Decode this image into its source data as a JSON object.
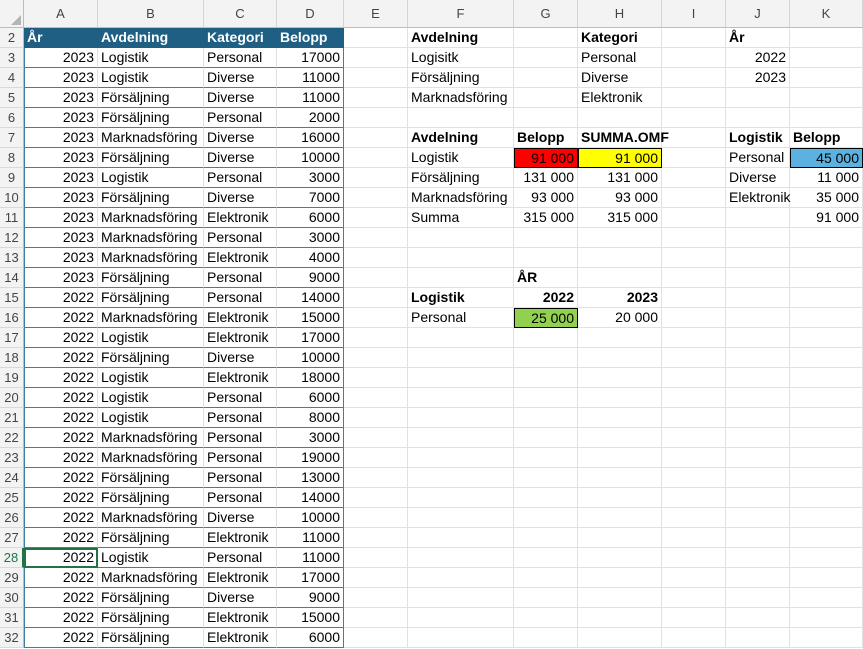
{
  "columns": [
    "A",
    "B",
    "C",
    "D",
    "E",
    "F",
    "G",
    "H",
    "I",
    "J",
    "K"
  ],
  "rows": [
    "2",
    "3",
    "4",
    "5",
    "6",
    "7",
    "8",
    "9",
    "10",
    "11",
    "12",
    "13",
    "14",
    "15",
    "16",
    "17",
    "18",
    "19",
    "20",
    "21",
    "22",
    "23",
    "24",
    "25",
    "26",
    "27",
    "28",
    "29",
    "30",
    "31",
    "32"
  ],
  "selected_row": "28",
  "colors": {
    "header_fill": "#1f5f83",
    "red": "#ff0000",
    "yellow": "#ffff00",
    "green": "#92d050",
    "blue": "#5bb1df",
    "selection": "#217346"
  },
  "table": {
    "headers": [
      "År",
      "Avdelning",
      "Kategori",
      "Belopp"
    ],
    "rows": [
      [
        "2023",
        "Logistik",
        "Personal",
        "17000"
      ],
      [
        "2023",
        "Logistik",
        "Diverse",
        "11000"
      ],
      [
        "2023",
        "Försäljning",
        "Diverse",
        "11000"
      ],
      [
        "2023",
        "Försäljning",
        "Personal",
        "2000"
      ],
      [
        "2023",
        "Marknadsföring",
        "Diverse",
        "16000"
      ],
      [
        "2023",
        "Försäljning",
        "Diverse",
        "10000"
      ],
      [
        "2023",
        "Logistik",
        "Personal",
        "3000"
      ],
      [
        "2023",
        "Försäljning",
        "Diverse",
        "7000"
      ],
      [
        "2023",
        "Marknadsföring",
        "Elektronik",
        "6000"
      ],
      [
        "2023",
        "Marknadsföring",
        "Personal",
        "3000"
      ],
      [
        "2023",
        "Marknadsföring",
        "Elektronik",
        "4000"
      ],
      [
        "2023",
        "Försäljning",
        "Personal",
        "9000"
      ],
      [
        "2022",
        "Försäljning",
        "Personal",
        "14000"
      ],
      [
        "2022",
        "Marknadsföring",
        "Elektronik",
        "15000"
      ],
      [
        "2022",
        "Logistik",
        "Elektronik",
        "17000"
      ],
      [
        "2022",
        "Försäljning",
        "Diverse",
        "10000"
      ],
      [
        "2022",
        "Logistik",
        "Elektronik",
        "18000"
      ],
      [
        "2022",
        "Logistik",
        "Personal",
        "6000"
      ],
      [
        "2022",
        "Logistik",
        "Personal",
        "8000"
      ],
      [
        "2022",
        "Marknadsföring",
        "Personal",
        "3000"
      ],
      [
        "2022",
        "Marknadsföring",
        "Personal",
        "19000"
      ],
      [
        "2022",
        "Försäljning",
        "Personal",
        "13000"
      ],
      [
        "2022",
        "Försäljning",
        "Personal",
        "14000"
      ],
      [
        "2022",
        "Marknadsföring",
        "Diverse",
        "10000"
      ],
      [
        "2022",
        "Försäljning",
        "Elektronik",
        "11000"
      ],
      [
        "2022",
        "Logistik",
        "Personal",
        "11000"
      ],
      [
        "2022",
        "Marknadsföring",
        "Elektronik",
        "17000"
      ],
      [
        "2022",
        "Försäljning",
        "Diverse",
        "9000"
      ],
      [
        "2022",
        "Försäljning",
        "Elektronik",
        "15000"
      ],
      [
        "2022",
        "Försäljning",
        "Elektronik",
        "6000"
      ]
    ]
  },
  "criteria": {
    "avd_header": "Avdelning",
    "avd_items": [
      "Logisitk",
      "Försäljning",
      "Marknadsföring"
    ],
    "kat_header": "Kategori",
    "kat_items": [
      "Personal",
      "Diverse",
      "Elektronik"
    ],
    "ar_header": "År",
    "ar_items": [
      "2022",
      "2023"
    ]
  },
  "summary": {
    "headers": [
      "Avdelning",
      "Belopp",
      "SUMMA.OMF"
    ],
    "rows": [
      [
        "Logistik",
        "91 000",
        "91 000"
      ],
      [
        "Försäljning",
        "131 000",
        "131 000"
      ],
      [
        "Marknadsföring",
        "93 000",
        "93 000"
      ],
      [
        "Summa",
        "315 000",
        "315 000"
      ]
    ]
  },
  "logistik_table": {
    "headers": [
      "Logistik",
      "Belopp"
    ],
    "rows": [
      [
        "Personal",
        "45 000"
      ],
      [
        "Diverse",
        "11 000"
      ],
      [
        "Elektronik",
        "35 000"
      ],
      [
        "",
        "91 000"
      ]
    ]
  },
  "year_table": {
    "title": "ÅR",
    "label": "Logistik",
    "years": [
      "2022",
      "2023"
    ],
    "row_label": "Personal",
    "values": [
      "25 000",
      "20 000"
    ]
  }
}
